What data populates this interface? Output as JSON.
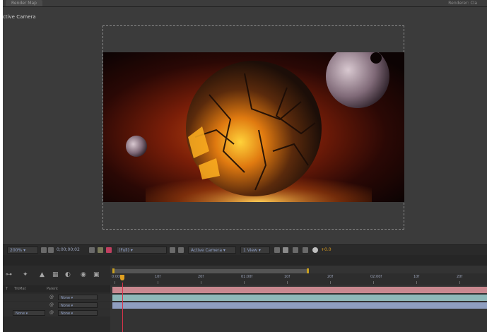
{
  "topbar": {
    "tab_label": "Render Map",
    "right_label": "Renderer: Cla"
  },
  "viewer": {
    "camera_label": "ctive Camera"
  },
  "viewer_toolbar": {
    "zoom": "200%",
    "timecode": "0;00;00;02",
    "resolution": "(Full)",
    "camera": "Active Camera",
    "views": "1 View",
    "exposure": "+0.0"
  },
  "timeline": {
    "columns": {
      "trkmat": "TrkMat",
      "parent": "Parent"
    },
    "layers": [
      {
        "trkmat": "",
        "parent": "None"
      },
      {
        "trkmat": "",
        "parent": "None"
      },
      {
        "trkmat": "None",
        "parent": "None"
      }
    ],
    "ruler": [
      "0:00f",
      "10f",
      "20f",
      "01:00f",
      "10f",
      "20f",
      "02:00f",
      "10f",
      "20f"
    ],
    "track_colors": [
      "#c9888f",
      "#8fb8b8",
      "#8f9ec0"
    ],
    "playhead_color": "#e0a020"
  }
}
